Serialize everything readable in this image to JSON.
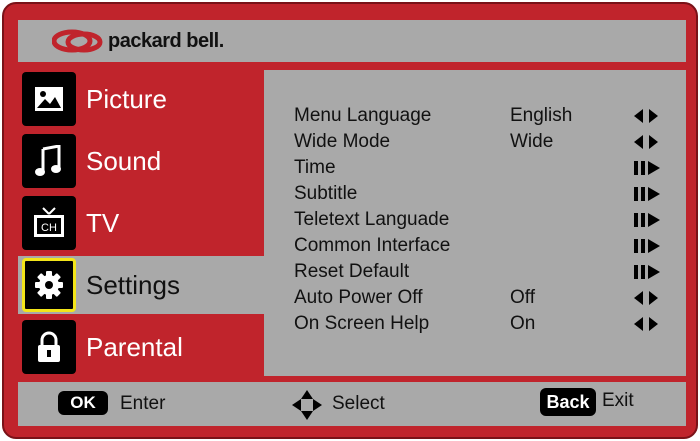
{
  "brand": {
    "name": "packard bell."
  },
  "menu": {
    "items": [
      {
        "label": "Picture",
        "icon": "picture-icon"
      },
      {
        "label": "Sound",
        "icon": "music-note-icon"
      },
      {
        "label": "TV",
        "icon": "tv-channel-icon"
      },
      {
        "label": "Settings",
        "icon": "gear-icon",
        "active": true
      },
      {
        "label": "Parental",
        "icon": "lock-icon"
      }
    ]
  },
  "settings": {
    "rows": [
      {
        "name": "Menu Language",
        "value": "English",
        "control": "left-right-arrows"
      },
      {
        "name": "Wide Mode",
        "value": "Wide",
        "control": "left-right-arrows"
      },
      {
        "name": "Time",
        "value": "",
        "control": "enter-arrow"
      },
      {
        "name": "Subtitle",
        "value": "",
        "control": "enter-arrow"
      },
      {
        "name": "Teletext Languade",
        "value": "",
        "control": "enter-arrow"
      },
      {
        "name": "Common Interface",
        "value": "",
        "control": "enter-arrow"
      },
      {
        "name": "Reset Default",
        "value": "",
        "control": "enter-arrow"
      },
      {
        "name": "Auto Power Off",
        "value": "Off",
        "control": "left-right-arrows"
      },
      {
        "name": "On Screen Help",
        "value": "On",
        "control": "left-right-arrows"
      }
    ]
  },
  "footer": {
    "ok_key": "OK",
    "ok_label": "Enter",
    "select_label": "Select",
    "back_key": "Back",
    "back_label": "Exit"
  },
  "colors": {
    "frame": "#c0242c",
    "panel": "#a9a9a9",
    "highlight": "#f3e51a"
  }
}
